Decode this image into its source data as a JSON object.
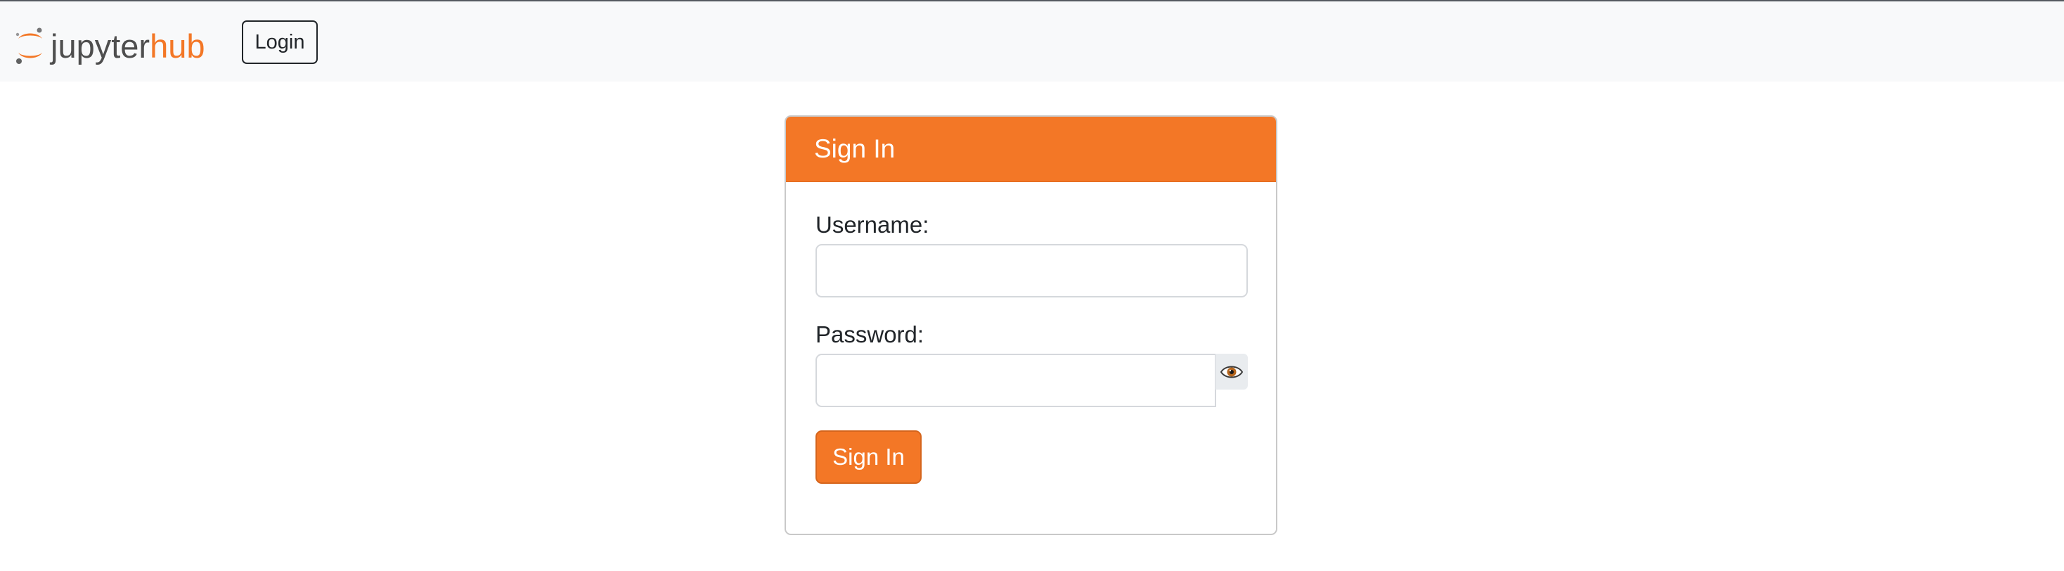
{
  "navbar": {
    "logo": {
      "text_part1": "jupyter",
      "text_part2": "hub",
      "icon": "jupyter-logo-icon"
    },
    "login_button": "Login"
  },
  "login_card": {
    "header": "Sign In",
    "username": {
      "label": "Username:",
      "value": "",
      "placeholder": ""
    },
    "password": {
      "label": "Password:",
      "value": "",
      "placeholder": "",
      "toggle_icon": "eye-icon"
    },
    "submit_button": "Sign In"
  },
  "colors": {
    "accent": "#f37726",
    "navbar_bg": "#f8f9fa",
    "text": "#212529",
    "logo_gray": "#4e4e4e"
  }
}
